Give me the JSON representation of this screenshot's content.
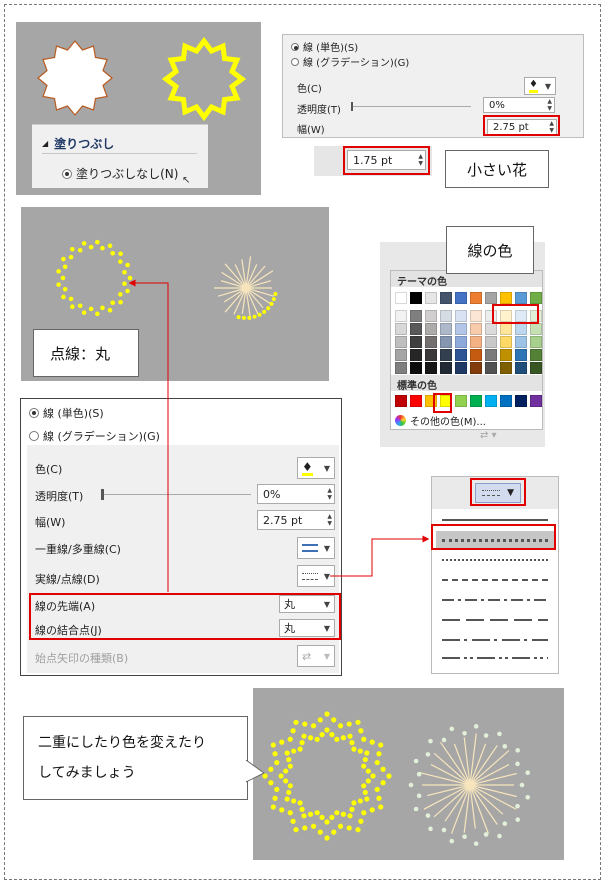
{
  "top_panel": {
    "fill_header": "塗りつぶし",
    "no_fill_label": "塗りつぶしなし(N)"
  },
  "line_panel_small": {
    "solid_label": "線 (単色)(S)",
    "gradient_label": "線 (グラデーション)(G)",
    "color_label": "色(C)",
    "transparency_label": "透明度(T)",
    "transparency_value": "0%",
    "width_label": "幅(W)",
    "width_value": "2.75 pt"
  },
  "small_width_field": {
    "value": "1.75 pt"
  },
  "callouts": {
    "small_flower": "小さい花",
    "line_color": "線の色",
    "dotted_round": "点線：丸",
    "advice_line1": "二重にしたり色を変えたり",
    "advice_line2": "してみましょう"
  },
  "palette": {
    "theme_header": "テーマの色",
    "standard_header": "標準の色",
    "other_colors": "その他の色(M)...",
    "theme_top": [
      "#ffffff",
      "#000000",
      "#e7e6e6",
      "#44546a",
      "#4472c4",
      "#ed7d31",
      "#a5a5a5",
      "#ffc000",
      "#5b9bd5",
      "#70ad47"
    ],
    "theme_shades": [
      [
        "#f2f2f2",
        "#7f7f7f",
        "#d0cece",
        "#d6dce4",
        "#d9e2f3",
        "#fbe5d5",
        "#ededed",
        "#fff2cc",
        "#deebf6",
        "#e2efd9"
      ],
      [
        "#d8d8d8",
        "#595959",
        "#aeabab",
        "#adb9ca",
        "#b4c6e7",
        "#f7cbac",
        "#dbdbdb",
        "#fee599",
        "#bdd7ee",
        "#c5e0b3"
      ],
      [
        "#bfbfbf",
        "#3f3f3f",
        "#757070",
        "#8496b0",
        "#8eaadb",
        "#f4b183",
        "#c9c9c9",
        "#ffd965",
        "#9dc3e6",
        "#a8d08d"
      ],
      [
        "#a5a5a5",
        "#262626",
        "#3a3838",
        "#323f4f",
        "#2f5496",
        "#c55a11",
        "#7b7b7b",
        "#bf9000",
        "#2e75b5",
        "#538135"
      ],
      [
        "#7f7f7f",
        "#0c0c0c",
        "#171616",
        "#222a35",
        "#1f3864",
        "#833c0b",
        "#525252",
        "#7f6000",
        "#1e4e79",
        "#375623"
      ]
    ],
    "standard": [
      "#c00000",
      "#ff0000",
      "#ffc000",
      "#ffff00",
      "#92d050",
      "#00b050",
      "#00b0f0",
      "#0070c0",
      "#002060",
      "#7030a0"
    ]
  },
  "line_panel_large": {
    "solid_label": "線 (単色)(S)",
    "gradient_label": "線 (グラデーション)(G)",
    "color_label": "色(C)",
    "transparency_label": "透明度(T)",
    "transparency_value": "0%",
    "width_label": "幅(W)",
    "width_value": "2.75 pt",
    "compound_label": "一重線/多重線(C)",
    "dash_label": "実線/点線(D)",
    "cap_label": "線の先端(A)",
    "cap_value": "丸",
    "join_label": "線の結合点(J)",
    "join_value": "丸",
    "arrow_label": "始点矢印の種類(B)"
  },
  "colors": {
    "accent_red": "#e00000",
    "yellow": "#ffff00",
    "cream": "#f7e5bd",
    "gray_bg": "#a6a6a6",
    "pale_green": "#e2efd9"
  }
}
